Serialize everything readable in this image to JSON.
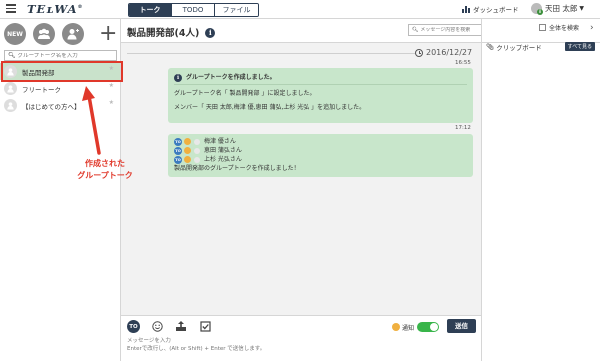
{
  "app": {
    "logo": "TEʟWA",
    "logo_mark": "®"
  },
  "tabs": [
    {
      "label": "トーク",
      "active": true
    },
    {
      "label": "TODO",
      "active": false
    },
    {
      "label": "ファイル",
      "active": false
    }
  ],
  "header": {
    "dashboard_label": "ダッシュボード",
    "user_name": "天田 太郎",
    "user_badge": "8"
  },
  "sidebar": {
    "new_button": "NEW",
    "search_placeholder": "グループトーク名を入力",
    "items": [
      {
        "label": "製品開発部",
        "active": true
      },
      {
        "label": "フリートーク",
        "active": false
      },
      {
        "label": "【はじめての方へ】",
        "active": false
      }
    ]
  },
  "annotation": {
    "line1": "作成された",
    "line2": "グループトーク"
  },
  "chat": {
    "title": "製品開発部(4人)",
    "search_placeholder": "メッセージ内容を検索",
    "date": "2016/12/27",
    "messages": [
      {
        "time": "16:55",
        "header": "グループトークを作成しました。",
        "lines": [
          "グループトーク名「 製品開発部 」に設定しました。",
          "メンバー「 天田 太郎,梅津 優,恵田 蒲弘,上杉 光弘 」を追加しました。"
        ]
      },
      {
        "time": "17:12",
        "mentions": [
          "梅津 優さん",
          "恵田 蒲弘さん",
          "上杉 光弘さん"
        ],
        "to_label": "TO",
        "text": "製品開発部のグループトークを作成しました！"
      }
    ]
  },
  "composer": {
    "to_label": "TO",
    "notify_label": "通知",
    "send_label": "送信",
    "placeholder": "メッセージを入力\nEnterで改行し、(Alt or Shift) + Enter で送信します。"
  },
  "clipboard": {
    "all_search_label": "全体を検索",
    "title": "クリップボード",
    "view_all_label": "すべて見る"
  },
  "colors": {
    "navy": "#2e3f55",
    "bubble_green": "#c8e6cb",
    "active_green": "#c9e2cb",
    "annotation_red": "#e0382a",
    "toggle_green": "#39b54a"
  }
}
